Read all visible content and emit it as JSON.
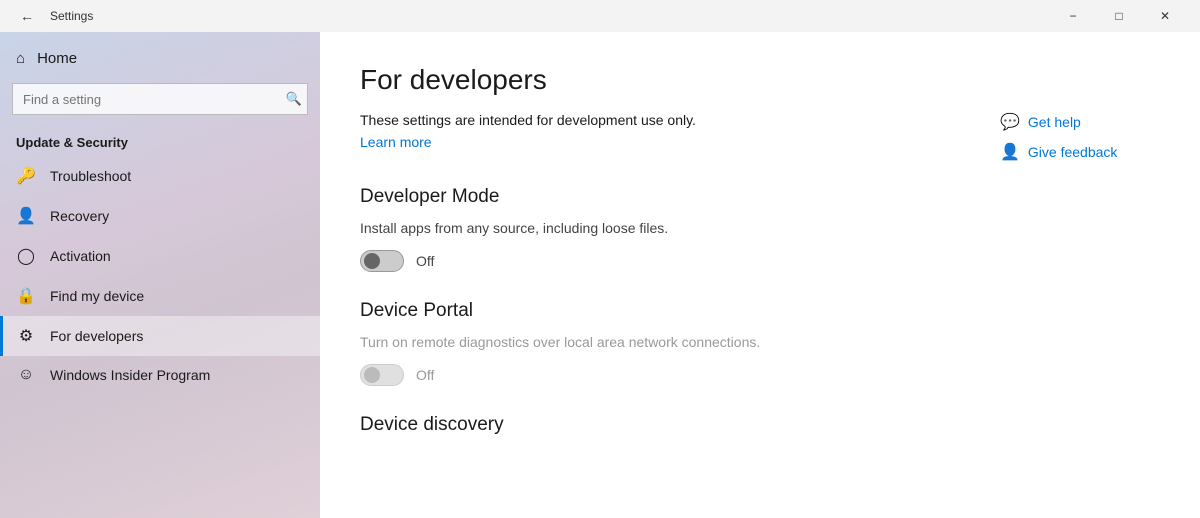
{
  "titlebar": {
    "title": "Settings",
    "minimize_label": "−",
    "maximize_label": "□",
    "close_label": "✕"
  },
  "sidebar": {
    "home_label": "Home",
    "search_placeholder": "Find a setting",
    "section_title": "Update & Security",
    "items": [
      {
        "id": "troubleshoot",
        "label": "Troubleshoot",
        "icon": "🔑"
      },
      {
        "id": "recovery",
        "label": "Recovery",
        "icon": "👤"
      },
      {
        "id": "activation",
        "label": "Activation",
        "icon": "⊙"
      },
      {
        "id": "find-my-device",
        "label": "Find my device",
        "icon": "🔒"
      },
      {
        "id": "for-developers",
        "label": "For developers",
        "icon": "⚙"
      },
      {
        "id": "windows-insider",
        "label": "Windows Insider Program",
        "icon": "☺"
      }
    ]
  },
  "main": {
    "page_title": "For developers",
    "description": "These settings are intended for development use only.",
    "learn_more_label": "Learn more",
    "help_links": [
      {
        "id": "get-help",
        "label": "Get help",
        "icon": "💬"
      },
      {
        "id": "give-feedback",
        "label": "Give feedback",
        "icon": "👤"
      }
    ],
    "sections": [
      {
        "id": "developer-mode",
        "heading": "Developer Mode",
        "description": "Install apps from any source, including loose files.",
        "toggle_state": "off",
        "toggle_label": "Off",
        "disabled": false
      },
      {
        "id": "device-portal",
        "heading": "Device Portal",
        "description": "Turn on remote diagnostics over local area network connections.",
        "toggle_state": "off",
        "toggle_label": "Off",
        "disabled": true
      },
      {
        "id": "device-discovery",
        "heading": "Device discovery",
        "description": "",
        "toggle_state": "off",
        "toggle_label": "",
        "disabled": false
      }
    ]
  }
}
